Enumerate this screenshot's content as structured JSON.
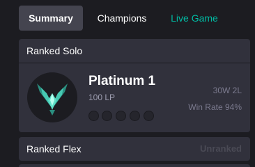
{
  "tabs": [
    {
      "label": "Summary",
      "active": true
    },
    {
      "label": "Champions",
      "active": false
    },
    {
      "label": "Live Game",
      "active": false
    }
  ],
  "ranked_solo": {
    "title": "Ranked Solo",
    "tier": "Platinum 1",
    "lp": "100 LP",
    "record": "30W 2L",
    "win_rate": "Win Rate 94%",
    "series_slots": 5,
    "emblem_icon": "platinum-emblem-icon"
  },
  "ranked_flex": {
    "title": "Ranked Flex",
    "status": "Unranked"
  },
  "colors": {
    "background": "#1c1c21",
    "card": "#31313c",
    "active_tab": "#44444f",
    "live_accent": "#00bba3",
    "emblem": "#2fb7a1",
    "muted_text": "#9e9eb1"
  }
}
